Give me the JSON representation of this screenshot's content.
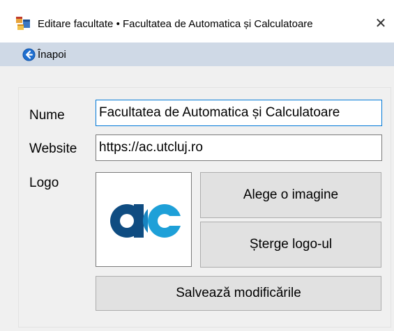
{
  "window": {
    "title": "Editare facultate • Facultatea de Automatica și Calculatoare",
    "close_glyph": "✕"
  },
  "menu": {
    "back_label": "Înapoi"
  },
  "form": {
    "name_label": "Nume",
    "name_value": "Facultatea de Automatica și Calculatoare",
    "website_label": "Website",
    "website_value": "https://ac.utcluj.ro",
    "logo_label": "Logo"
  },
  "buttons": {
    "choose_image": "Alege o imagine",
    "delete_logo": "Șterge logo-ul",
    "save_changes": "Salvează modificările"
  },
  "colors": {
    "menubar_bg": "#cfd9e6",
    "logo_blue": "#0f4c81",
    "logo_cyan": "#1ea0d8",
    "focus_border": "#0078d7"
  },
  "icons": {
    "app": "app-form-icon",
    "back": "circle-arrow-left-icon",
    "close": "close-icon",
    "logo": "ac-logo"
  }
}
